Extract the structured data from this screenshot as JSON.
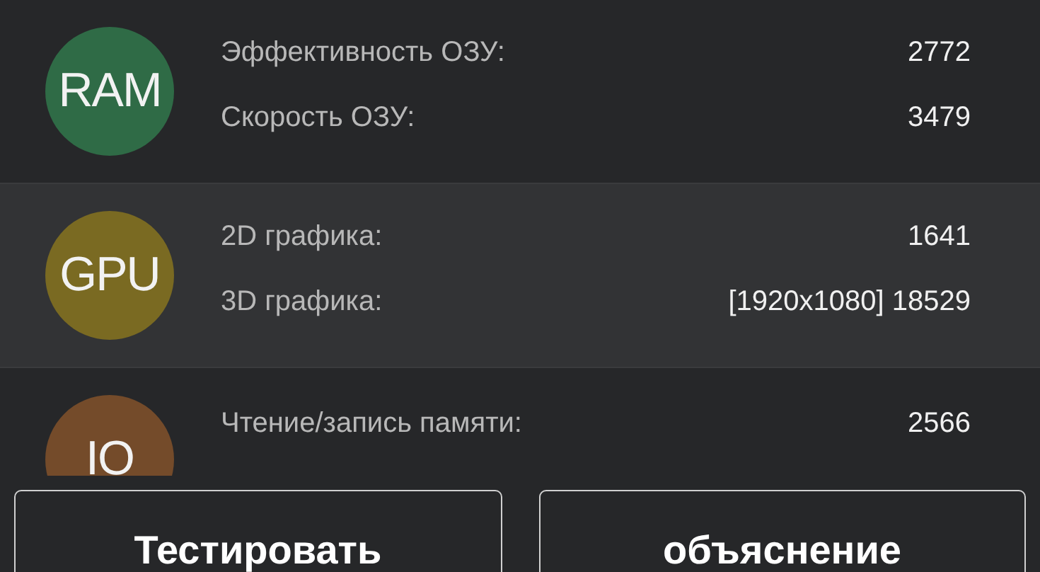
{
  "sections": [
    {
      "badge": "RAM",
      "color": "#2f6b46",
      "selected": false,
      "rows": [
        {
          "label": "Эффективность ОЗУ:",
          "value": "2772"
        },
        {
          "label": "Скорость ОЗУ:",
          "value": "3479"
        }
      ]
    },
    {
      "badge": "GPU",
      "color": "#7a6a22",
      "selected": true,
      "rows": [
        {
          "label": "2D графика:",
          "value": "1641"
        },
        {
          "label": "3D графика:",
          "value": "[1920x1080] 18529"
        }
      ]
    },
    {
      "badge": "IO",
      "color": "#744b2a",
      "selected": false,
      "rows": [
        {
          "label": "Чтение/запись памяти:",
          "value": "2566"
        }
      ]
    }
  ],
  "buttons": [
    "Тестировать",
    "объяснение"
  ]
}
